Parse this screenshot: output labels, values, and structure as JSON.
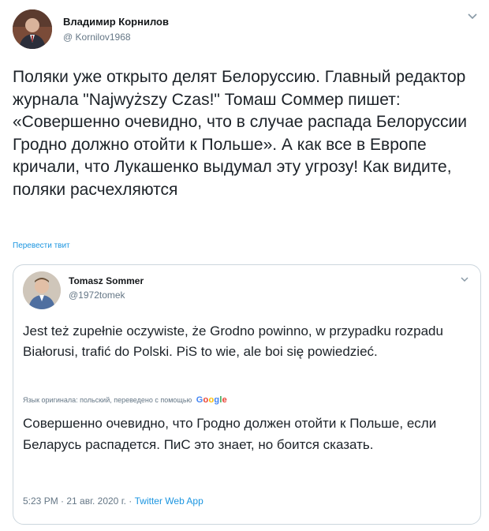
{
  "tweet": {
    "author": {
      "name": "Владимир Корнилов",
      "handle": "@ Kornilov1968"
    },
    "text": "Поляки уже открыто делят Белоруссию. Главный редактор журнала \"Najwyższy Czas!\" Томаш Соммер пишет: «Совершенно очевидно, что в случае распада Белоруссии Гродно должно отойти к Польше». А как все в Европе кричали, что Лукашенко выдумал эту угрозу! Как видите, поляки расчехляются",
    "translate_link": "Перевести твит"
  },
  "quoted_tweet": {
    "author": {
      "name": "Tomasz Sommer",
      "handle": "@1972tomek"
    },
    "original_text": "Jest też zupełnie oczywiste, że Grodno powinno, w przypadku rozpadu Białorusi, trafić do Polski. PiS to wie, ale boi się powiedzieć.",
    "translation_note": "Язык оригинала: польский, переведено с помощью",
    "translation_provider": "Google",
    "translated_text": "Совершенно очевидно, что Гродно должен отойти к Польше, если Беларусь распадется. ПиС это знает, но боится сказать.",
    "timestamp": "5:23 PM · 21 авг. 2020 г. ·",
    "source": "Twitter Web App"
  },
  "colors": {
    "link": "#1b95e0",
    "secondary_text": "#657786",
    "border": "#ccd6dd"
  },
  "icons": [
    "chevron-down-icon",
    "avatar"
  ]
}
